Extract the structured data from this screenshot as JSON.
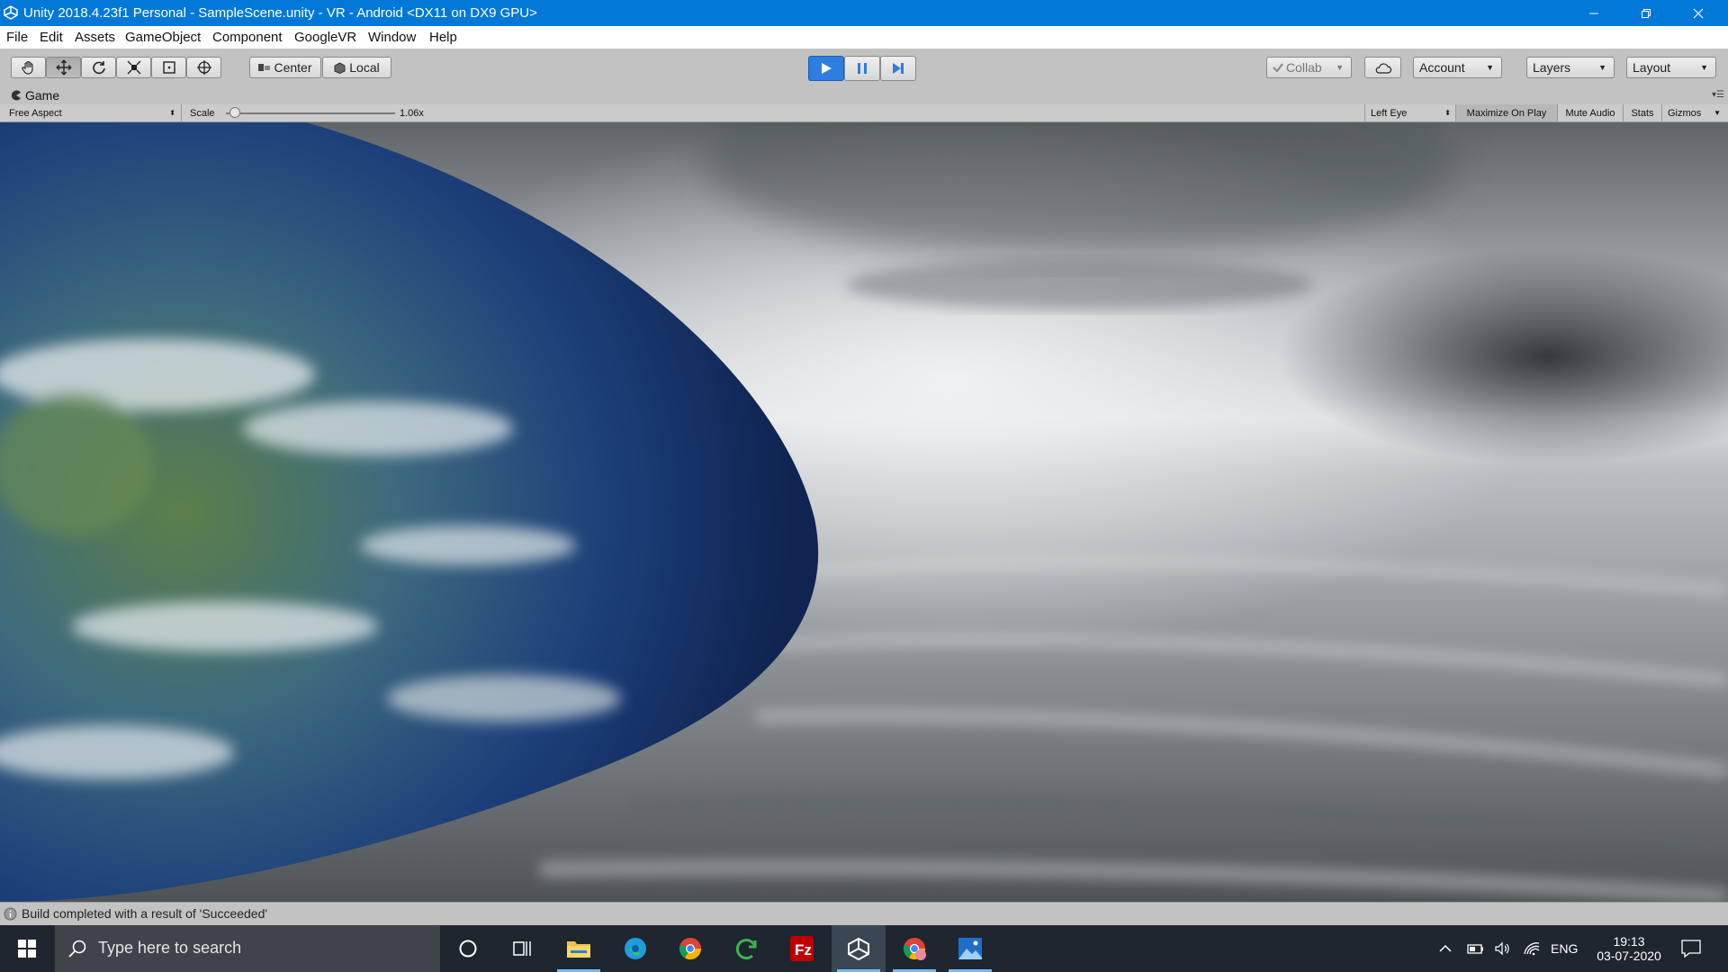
{
  "window": {
    "title": "Unity 2018.4.23f1 Personal - SampleScene.unity - VR - Android <DX11 on DX9 GPU>"
  },
  "menu": [
    "File",
    "Edit",
    "Assets",
    "GameObject",
    "Component",
    "GoogleVR",
    "Window",
    "Help"
  ],
  "toolbar": {
    "tools": [
      "hand-tool",
      "move-tool",
      "rotate-tool",
      "scale-tool",
      "rect-tool",
      "transform-tool"
    ],
    "pivot_center": "Center",
    "pivot_local": "Local",
    "collab": "Collab",
    "account": "Account",
    "layers": "Layers",
    "layout": "Layout",
    "play_active": true
  },
  "game": {
    "tab_label": "Game",
    "aspect": "Free Aspect",
    "scale_label": "Scale",
    "scale_value": "1.06x",
    "scale_fraction": 0.02,
    "eye": "Left Eye",
    "maximize": "Maximize On Play",
    "mute": "Mute Audio",
    "stats": "Stats",
    "gizmos": "Gizmos"
  },
  "status": {
    "message": "Build completed with a result of 'Succeeded'"
  },
  "taskbar": {
    "search_placeholder": "Type here to search",
    "lang": "ENG",
    "time": "19:13",
    "date": "03-07-2020"
  },
  "colors": {
    "titlebar": "#0078d7",
    "play_blue": "#2e7de0",
    "taskbar": "#1f2630"
  }
}
